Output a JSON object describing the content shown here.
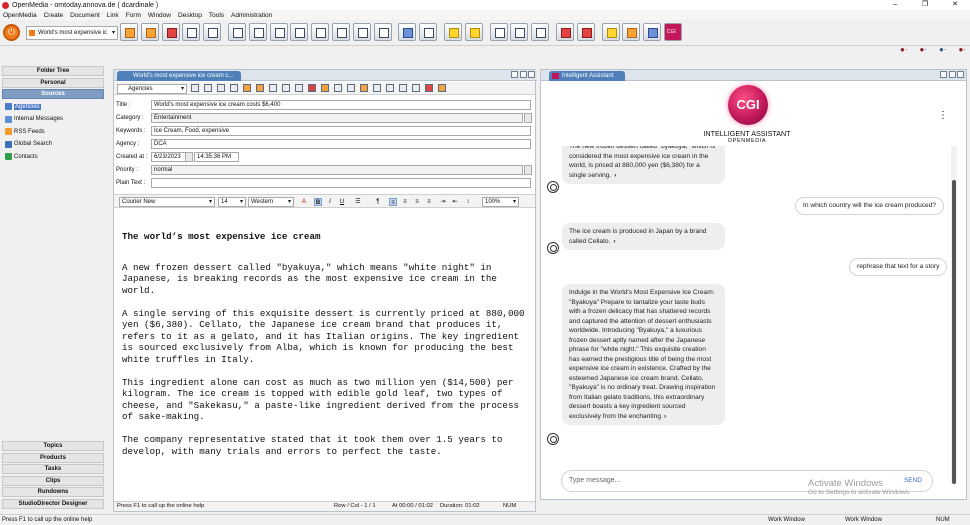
{
  "window": {
    "title": "OpenMedia - omtoday.annova.de ( dcardinale )",
    "min": "–",
    "max": "❐",
    "close": "✕"
  },
  "menu": [
    "OpenMedia",
    "Create",
    "Document",
    "Link",
    "Form",
    "Window",
    "Desktop",
    "Tools",
    "Administration"
  ],
  "toolbar": {
    "doc_selector": "World's most expensive ic",
    "dropdown": "▾",
    "power_icon": "⏻",
    "status_dots": [
      "●·",
      "●·",
      "●·",
      "●·"
    ]
  },
  "left_nav": {
    "top_headers": [
      "Folder Tree",
      "Personal",
      "Sources"
    ],
    "items": [
      {
        "label": "Agencies",
        "color": "#4b7ac6",
        "selected": true
      },
      {
        "label": "Internal Messages",
        "color": "#5b8fd6",
        "selected": false
      },
      {
        "label": "RSS Feeds",
        "color": "#f39c2b",
        "selected": false
      },
      {
        "label": "Global Search",
        "color": "#3c6fb8",
        "selected": false
      },
      {
        "label": "Contacts",
        "color": "#2e9e4a",
        "selected": false
      }
    ],
    "bottom_headers": [
      "Topics",
      "Products",
      "Tasks",
      "Clips",
      "Rundowns",
      "StudioDirector Designer"
    ]
  },
  "document": {
    "tab_title": "World's most expensive ice cream c...",
    "source_select": "Agencies",
    "fields": {
      "title_label": "Title :",
      "title": "World's most expensive ice cream costs $6,400",
      "category_label": "Category :",
      "category": "Entertainment",
      "keywords_label": "Keywords :",
      "keywords": "Ice Cream, Food, expensive",
      "agency_label": "Agency :",
      "agency": "DCA",
      "created_label": "Created at :",
      "created_date": "6/23/2023",
      "created_time": "14:35:36 PM",
      "priority_label": "Priority :",
      "priority": "normal",
      "plain_text_label": "Plain Text :",
      "plain_text": ""
    },
    "format": {
      "font": "Courier New",
      "size": "14",
      "script": "Western",
      "zoom": "100%",
      "bold": "B",
      "italic": "I",
      "underline": "U"
    },
    "heading": "The world’s most expensive ice cream",
    "paragraphs": [
      "A new frozen dessert called \"byakuya,\" which means \"white night\" in Japanese, is breaking records as the most expensive ice cream in the world.",
      "A single serving of this exquisite dessert is currently priced at 880,000 yen ($6,380). Cellato, the Japanese ice cream brand that produces it, refers to it as a gelato, and it has Italian origins. The key ingredient is sourced exclusively from Alba, which is known for producing the best white truffles in Italy.",
      "This ingredient alone can cost as much as two million yen ($14,500) per kilogram. The ice cream is topped with edible gold leaf, two types of cheese, and \"Sakekasu,\" a paste-like ingredient derived from the process of sake-making.",
      "The company representative stated that it took them over 1.5 years to develop, with many trials and errors to perfect the taste."
    ],
    "status": {
      "help": "Press F1 to call up the online help",
      "rowcol": "Row / Col - 1 / 1",
      "at": "At 00:00 / 01:02",
      "duration": "Duration: 01:02",
      "num": "NUM"
    }
  },
  "assistant": {
    "tab_title": "Intelligent Assistant",
    "logo": "CGI",
    "title": "INTELLIGENT ASSISTANT",
    "subtitle": "OPENMEDIA",
    "menu_icon": "⋮",
    "messages": [
      {
        "role": "bot",
        "text": "The new frozen dessert called \"byakuya,\" which is considered the most expensive ice cream in the world, is priced at 880,000 yen ($6,380) for a single serving."
      },
      {
        "role": "user",
        "text": "In which country will the ice cream produced?"
      },
      {
        "role": "bot",
        "text": "The ice cream is produced in Japan by a brand called Cellato."
      },
      {
        "role": "user",
        "text": "rephrase that text for a story"
      },
      {
        "role": "bot",
        "text": "Indulge in the World's Most Expensive Ice Cream: \"Byakuya\" Prepare to tantalize your taste buds with a frozen delicacy that has shattered records and captured the attention of dessert enthusiasts worldwide. Introducing \"Byakuya,\" a luxurious frozen dessert aptly named after the Japanese phrase for \"white night.\" This exquisite creation has earned the prestigious title of being the most expensive ice cream in existence. Crafted by the esteemed Japanese ice cream brand, Cellato, \"Byakuya\" is no ordinary treat. Drawing inspiration from Italian gelato traditions, this extraordinary dessert boasts a key ingredient sourced exclusively from the enchanting"
      }
    ],
    "input_placeholder": "Type message...",
    "send_label": "SEND",
    "watermark_title": "Activate Windows",
    "watermark_sub": "Go to Settings to activate Windows."
  },
  "statusbar": {
    "help": "Press F1 to call up the online help",
    "work1": "Work Window",
    "work2": "Work Window",
    "num": "NUM"
  }
}
